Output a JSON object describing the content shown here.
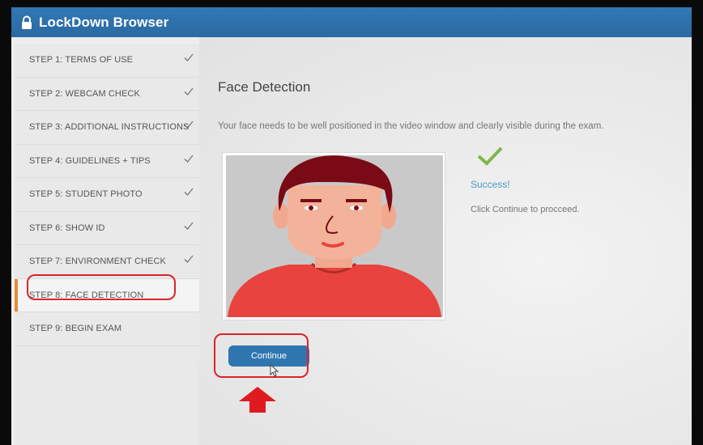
{
  "app": {
    "title": "LockDown Browser"
  },
  "sidebar": {
    "steps": [
      {
        "label": "STEP 1: TERMS OF USE",
        "done": true
      },
      {
        "label": "STEP 2: WEBCAM CHECK",
        "done": true
      },
      {
        "label": "STEP 3: ADDITIONAL INSTRUCTIONS",
        "done": true
      },
      {
        "label": "STEP 4: GUIDELINES + TIPS",
        "done": true
      },
      {
        "label": "STEP 5: STUDENT PHOTO",
        "done": true
      },
      {
        "label": "STEP 6: SHOW ID",
        "done": true
      },
      {
        "label": "STEP 7: ENVIRONMENT CHECK",
        "done": true
      },
      {
        "label": "STEP 8: FACE DETECTION",
        "done": false,
        "active": true
      },
      {
        "label": "STEP 9: BEGIN EXAM",
        "done": false
      }
    ]
  },
  "main": {
    "heading": "Face Detection",
    "description": "Your face needs to be well positioned in the video window and clearly visible during the exam.",
    "status": {
      "title": "Success!",
      "message": "Click Continue to procceed."
    },
    "continue_label": "Continue"
  },
  "colors": {
    "titlebar": "#2b6aa2",
    "accent_button": "#2f76b0",
    "success_check": "#7db84a",
    "annotation_red": "#d8262a",
    "active_marker": "#e08c3a"
  }
}
